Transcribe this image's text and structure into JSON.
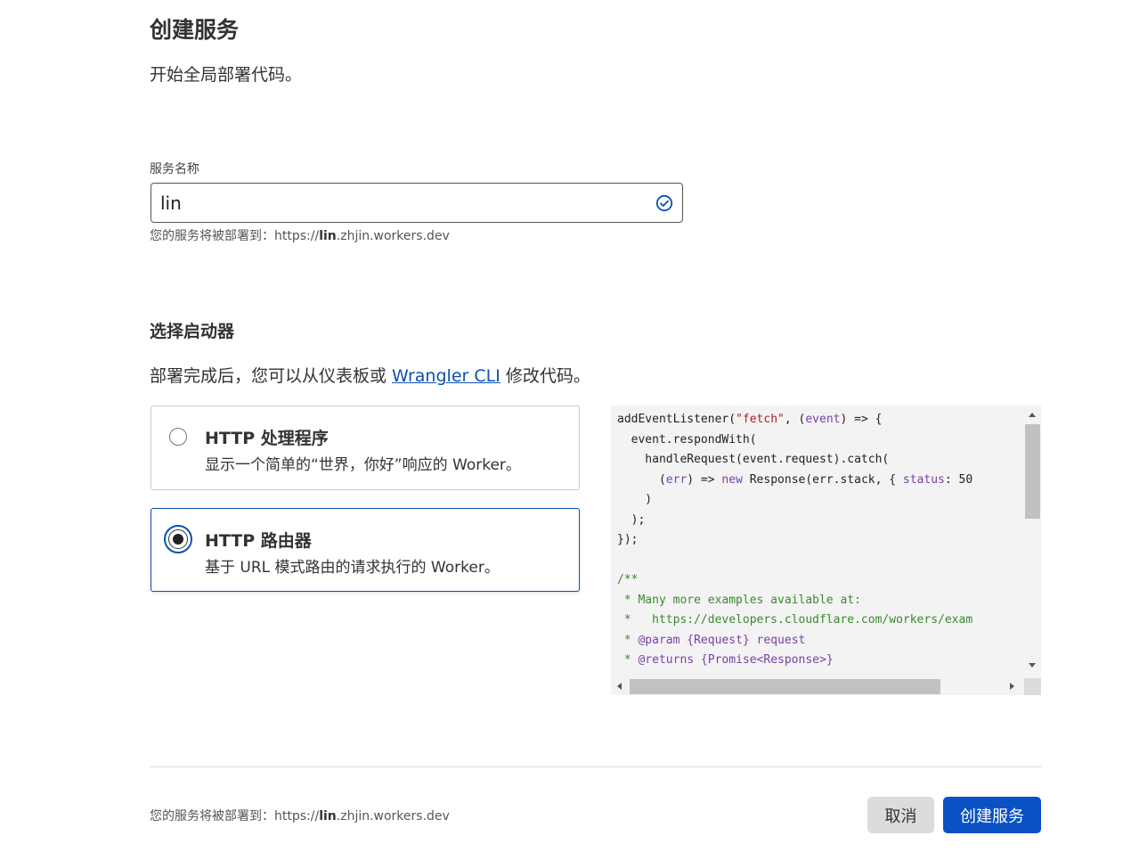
{
  "page": {
    "title": "创建服务",
    "subtitle": "开始全局部署代码。"
  },
  "service_name": {
    "label": "服务名称",
    "value": "lin",
    "hint_prefix": "您的服务将被部署到：https://",
    "hint_name": "lin",
    "hint_suffix": ".zhjin.workers.dev"
  },
  "starter": {
    "heading": "选择启动器",
    "desc_before": "部署完成后，您可以从仪表板或 ",
    "desc_link": "Wrangler CLI",
    "desc_after": " 修改代码。",
    "options": [
      {
        "title": "HTTP 处理程序",
        "desc": "显示一个简单的“世界，你好”响应的 Worker。",
        "selected": false
      },
      {
        "title": "HTTP 路由器",
        "desc": "基于 URL 模式路由的请求执行的 Worker。",
        "selected": true
      }
    ]
  },
  "footer": {
    "hint_prefix": "您的服务将被部署到：https://",
    "hint_name": "lin",
    "hint_suffix": ".zhjin.workers.dev",
    "cancel_label": "取消",
    "create_label": "创建服务"
  },
  "code": {
    "line_1_a": "addEventListener(",
    "line_1_str": "\"fetch\"",
    "line_1_b": ", (",
    "line_1_kw": "event",
    "line_1_c": ") => {",
    "line_2": "  event.respondWith(",
    "line_3": "    handleRequest(event.request).catch(",
    "line_4_a": "      (",
    "line_4_kw1": "err",
    "line_4_b": ") => ",
    "line_4_kw2": "new",
    "line_4_c": " Response(err.stack, { ",
    "line_4_kw3": "status",
    "line_4_d": ": 50",
    "line_5": "    )",
    "line_6": "  );",
    "line_7": "});",
    "line_8": "",
    "line_9": "/**",
    "line_10": " * Many more examples available at:",
    "line_11": " *   https://developers.cloudflare.com/workers/exam",
    "line_12_a": " * ",
    "line_12_kw": "@param",
    "line_12_b": " {Request}",
    "line_12_c": " request",
    "line_13_a": " * ",
    "line_13_kw": "@returns",
    "line_13_b": " {Promise<Response>}"
  },
  "colors": {
    "accent": "#0a51c4",
    "link": "#0a51b3"
  }
}
